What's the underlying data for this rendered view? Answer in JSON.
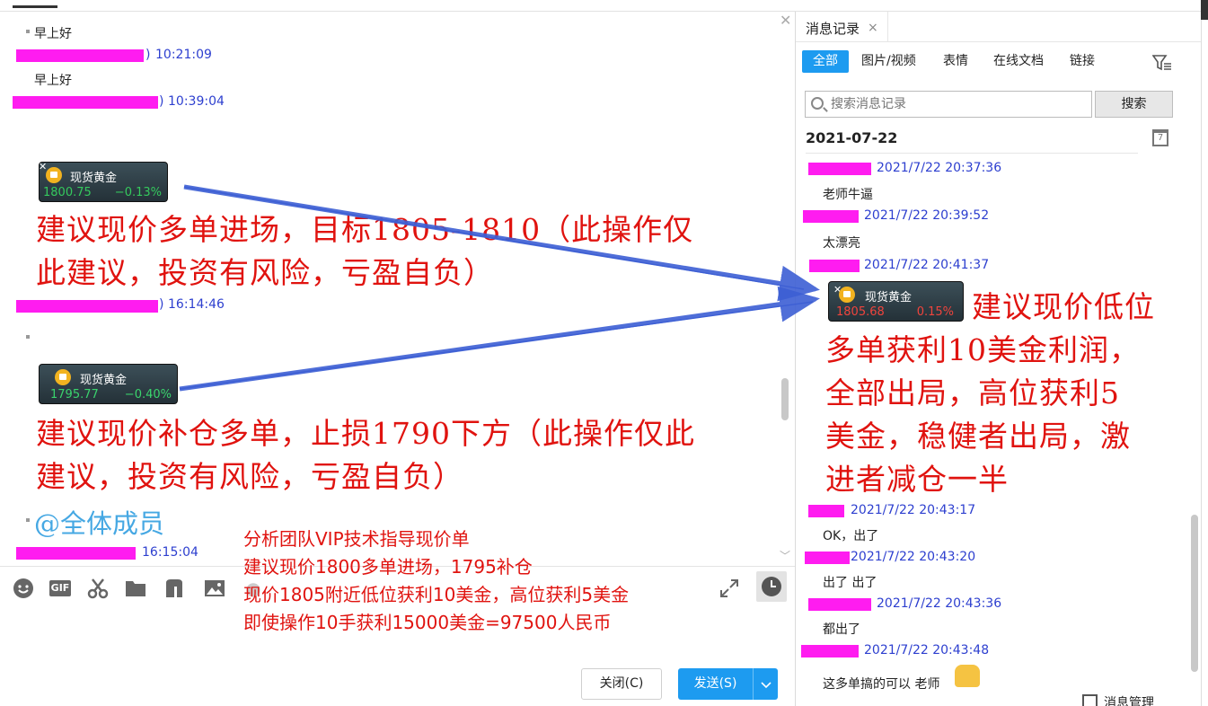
{
  "chat": {
    "messages": [
      {
        "text": "早上好"
      },
      {
        "time": "10:21:09"
      },
      {
        "text": "早上好"
      },
      {
        "time": "10:39:04"
      },
      {
        "time": "16:14:46"
      },
      {
        "time": "16:15:04"
      }
    ],
    "card1": {
      "name": "现货黄金",
      "price": "1800.75",
      "change": "−0.13%",
      "close": "✕"
    },
    "card2": {
      "name": "现货黄金",
      "price": "1795.77",
      "change": "−0.40%"
    },
    "annotation1": [
      "建议现价多单进场，目标1805-1810（此操作仅",
      "此建议，投资有风险，亏盈自负）"
    ],
    "annotation2": [
      "建议现价补仓多单，止损1790下方（此操作仅此",
      "建议，投资有风险，亏盈自负）"
    ],
    "mention": "@全体成员",
    "promo": [
      "分析团队VIP技术指导现价单",
      "建议现价1800多单进场，1795补仓",
      "现价1805附近低位获利10美金，高位获利5美金",
      "即使操作10手获利15000美金=97500人民币"
    ],
    "close_icon": "✕"
  },
  "toolbar": {
    "icons": [
      "emoji-icon",
      "gif-icon",
      "scissors-icon",
      "folder-icon",
      "music-icon",
      "image-icon",
      "expand-icon",
      "history-clock-icon"
    ],
    "gif_label": "GIF"
  },
  "footer": {
    "close_label": "关闭(C)",
    "send_label": "发送(S)",
    "send_dropdown": "﹀"
  },
  "panel": {
    "tab_title": "消息记录",
    "tab_close": "×",
    "filters": [
      "全部",
      "图片/视频",
      "表情",
      "在线文档",
      "链接"
    ],
    "search_placeholder": "搜索消息记录",
    "search_button": "搜索",
    "date": "2021-07-22",
    "calendar_day": "7",
    "records": [
      {
        "time": "2021/7/22 20:37:36",
        "text": "老师牛逼"
      },
      {
        "time": "2021/7/22 20:39:52",
        "text": "太漂亮"
      },
      {
        "time": "2021/7/22 20:41:37"
      },
      {
        "time": "2021/7/22 20:43:17",
        "text": "OK，出了"
      },
      {
        "time": "2021/7/22 20:43:20",
        "text": "出了 出了"
      },
      {
        "time": "2021/7/22 20:43:36",
        "text": "都出了"
      },
      {
        "time": "2021/7/22 20:43:48",
        "text": "这多单搞的可以 老师"
      }
    ],
    "card": {
      "name": "现货黄金",
      "price": "1805.68",
      "change": "0.15%",
      "close": "✕"
    },
    "annotation": [
      "建议现价低位",
      "多单获利10美金利润，",
      "全部出局，高位获利5",
      "美金，稳健者出局，激",
      "进者减仓一半"
    ],
    "manage_label": "消息管理"
  },
  "colors": {
    "accent": "#1d9bf0",
    "annotation_red": "#e0130f",
    "meta_blue": "#2d3fcf",
    "redaction": "#ff1cf0",
    "mention_blue": "#46a8e3"
  }
}
